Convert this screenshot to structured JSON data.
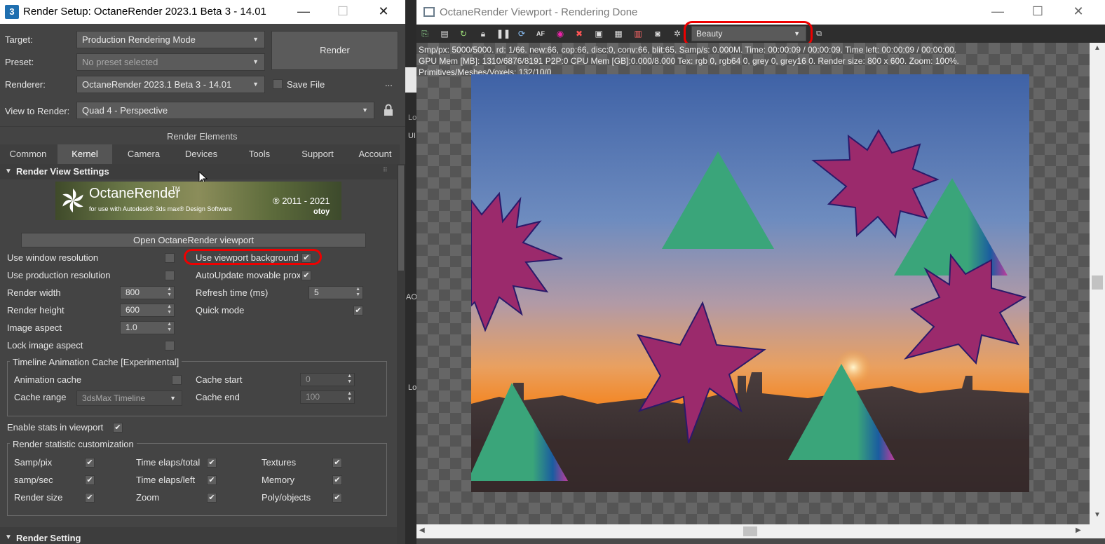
{
  "left_window": {
    "app_icon": "3",
    "title": "Render Setup: OctaneRender 2023.1 Beta 3 - 14.01",
    "minimize": "—",
    "maximize": "☐",
    "close": "✕",
    "target_label": "Target:",
    "target_value": "Production Rendering Mode",
    "preset_label": "Preset:",
    "preset_value": "No preset selected",
    "renderer_label": "Renderer:",
    "renderer_value": "OctaneRender 2023.1 Beta 3 - 14.01",
    "render_button": "Render",
    "save_file_label": "Save File",
    "more_button": "...",
    "view_label": "View to Render:",
    "view_value": "Quad 4 - Perspective",
    "render_elements": "Render Elements",
    "tabs": [
      "Common",
      "Kernel",
      "Camera",
      "Devices",
      "Tools",
      "Support",
      "Account"
    ],
    "active_tab": "Kernel",
    "rollout_title": "Render View Settings",
    "banner": {
      "product": "OctaneRender",
      "tm": "TM",
      "subtitle": "for use with Autodesk® 3ds max® Design Software",
      "years": "® 2011 - 2021",
      "brand": "otoy"
    },
    "open_viewport_button": "Open OctaneRender viewport",
    "settings": {
      "use_window_res": "Use window resolution",
      "use_viewport_bg": "Use viewport background",
      "use_production_res": "Use production resolution",
      "autoupdate": "AutoUpdate movable prox",
      "render_width": "Render width",
      "render_width_value": "800",
      "refresh_time": "Refresh time (ms)",
      "refresh_time_value": "5",
      "render_height": "Render height",
      "render_height_value": "600",
      "quick_mode": "Quick mode",
      "image_aspect": "Image aspect",
      "image_aspect_value": "1.0",
      "lock_aspect": "Lock image aspect"
    },
    "timeline": {
      "title": "Timeline Animation Cache [Experimental]",
      "animation_cache": "Animation cache",
      "cache_start": "Cache start",
      "cache_start_value": "0",
      "cache_range": "Cache range",
      "cache_range_value": "3dsMax Timeline",
      "cache_end": "Cache end",
      "cache_end_value": "100"
    },
    "enable_stats": "Enable stats in viewport",
    "stats": {
      "title": "Render statistic customization",
      "samp_pix": "Samp/pix",
      "time_elaps_total": "Time elaps/total",
      "textures": "Textures",
      "samp_sec": "samp/sec",
      "time_elaps_left": "Time elaps/left",
      "memory": "Memory",
      "render_size": "Render size",
      "zoom": "Zoom",
      "poly_objects": "Poly/objects"
    },
    "next_rollout": "Render Setting",
    "check_mark": "✔"
  },
  "right_window": {
    "title": "OctaneRender Viewport - Rendering Done",
    "minimize": "—",
    "maximize": "☐",
    "close": "✕",
    "pass_value": "Beauty",
    "stats_line1": "Smp/px: 5000/5000.   rd: 1/66.   new:66, cop:66, disc:0, conv:66, blit:65.   Samp/s: 0.000M.   Time: 00:00:09 / 00:00:09.   Time left: 00:00:09 / 00:00:00.",
    "stats_line2": "GPU Mem [MB]: 1310/6876/8191 P2P:0   CPU Mem [GB]:0.000/8.000   Tex: rgb 0, rgb64 0, grey 0, grey16 0.   Render size: 800 x 600.   Zoom: 100%.",
    "stats_line3": "Primitives/Meshes/Voxels: 132/10/0"
  },
  "partial_text": {
    "lo1": "Lo",
    "ui": "UI",
    "ao": "AO",
    "lo2": "Lo"
  },
  "colors": {
    "highlight": "#e00000",
    "triangle": "#3aa57a",
    "star": "#9b2a6c"
  }
}
